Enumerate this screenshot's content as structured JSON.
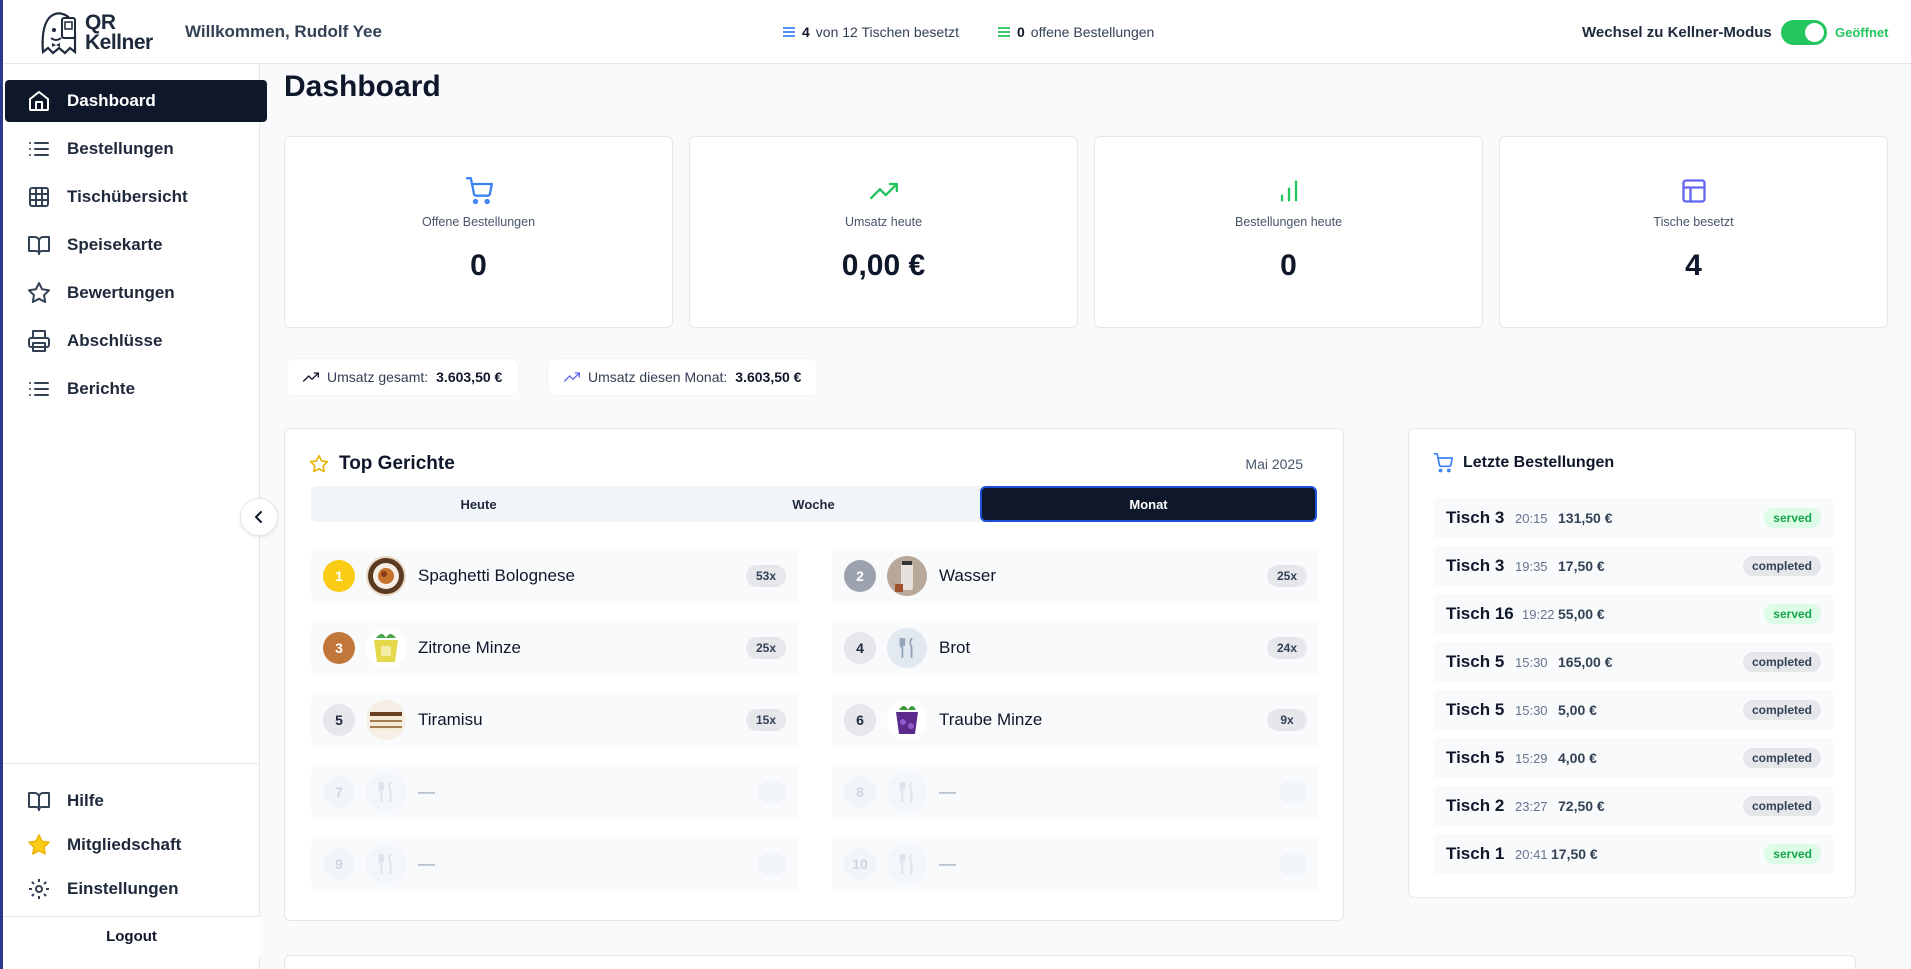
{
  "header": {
    "logo_line1": "QR",
    "logo_line2": "Kellner",
    "welcome": "Willkommen, Rudolf Yee",
    "tables_count": "4",
    "tables_text": "von 12 Tischen besetzt",
    "orders_count": "0",
    "orders_text": "offene Bestellungen",
    "mode_switch_label": "Wechsel zu Kellner-Modus",
    "open_status": "Geöffnet"
  },
  "sidebar": {
    "items": [
      {
        "label": "Dashboard",
        "icon": "home-icon"
      },
      {
        "label": "Bestellungen",
        "icon": "list-icon"
      },
      {
        "label": "Tischübersicht",
        "icon": "grid-icon"
      },
      {
        "label": "Speisekarte",
        "icon": "book-icon"
      },
      {
        "label": "Bewertungen",
        "icon": "star-icon"
      },
      {
        "label": "Abschlüsse",
        "icon": "printer-icon"
      },
      {
        "label": "Berichte",
        "icon": "list-icon"
      }
    ],
    "bottom_items": [
      {
        "label": "Hilfe",
        "icon": "book-icon"
      },
      {
        "label": "Mitgliedschaft",
        "icon": "star-icon"
      },
      {
        "label": "Einstellungen",
        "icon": "gear-icon"
      }
    ],
    "logout": "Logout"
  },
  "main": {
    "title": "Dashboard",
    "kpis": [
      {
        "label": "Offene Bestellungen",
        "value": "0",
        "icon": "cart-icon",
        "color": "#3b82f6"
      },
      {
        "label": "Umsatz heute",
        "value": "0,00 €",
        "icon": "trending-up-icon",
        "color": "#22c55e"
      },
      {
        "label": "Bestellungen heute",
        "value": "0",
        "icon": "bar-chart-icon",
        "color": "#22c55e"
      },
      {
        "label": "Tische besetzt",
        "value": "4",
        "icon": "table-icon",
        "color": "#6366f1"
      }
    ],
    "revenue_total_label": "Umsatz gesamt:",
    "revenue_total_value": "3.603,50 €",
    "revenue_month_label": "Umsatz diesen Monat:",
    "revenue_month_value": "3.603,50 €"
  },
  "top_dishes": {
    "title": "Top Gerichte",
    "period": "Mai 2025",
    "tabs": [
      "Heute",
      "Woche",
      "Monat"
    ],
    "active_tab": "Monat",
    "items": [
      {
        "rank": "1",
        "name": "Spaghetti Bolognese",
        "count": "53x"
      },
      {
        "rank": "2",
        "name": "Wasser",
        "count": "25x"
      },
      {
        "rank": "3",
        "name": "Zitrone Minze",
        "count": "25x"
      },
      {
        "rank": "4",
        "name": "Brot",
        "count": "24x"
      },
      {
        "rank": "5",
        "name": "Tiramisu",
        "count": "15x"
      },
      {
        "rank": "6",
        "name": "Traube Minze",
        "count": "9x"
      },
      {
        "rank": "7",
        "name": "—",
        "count": ""
      },
      {
        "rank": "8",
        "name": "—",
        "count": ""
      },
      {
        "rank": "9",
        "name": "—",
        "count": ""
      },
      {
        "rank": "10",
        "name": "—",
        "count": ""
      }
    ]
  },
  "recent_orders": {
    "title": "Letzte Bestellungen",
    "items": [
      {
        "table": "Tisch 3",
        "time": "20:15",
        "amount": "131,50 €",
        "status": "served"
      },
      {
        "table": "Tisch 3",
        "time": "19:35",
        "amount": "17,50 €",
        "status": "completed"
      },
      {
        "table": "Tisch 16",
        "time": "19:22",
        "amount": "55,00 €",
        "status": "served"
      },
      {
        "table": "Tisch 5",
        "time": "15:30",
        "amount": "165,00 €",
        "status": "completed"
      },
      {
        "table": "Tisch 5",
        "time": "15:30",
        "amount": "5,00 €",
        "status": "completed"
      },
      {
        "table": "Tisch 5",
        "time": "15:29",
        "amount": "4,00 €",
        "status": "completed"
      },
      {
        "table": "Tisch 2",
        "time": "23:27",
        "amount": "72,50 €",
        "status": "completed"
      },
      {
        "table": "Tisch 1",
        "time": "20:41",
        "amount": "17,50 €",
        "status": "served"
      }
    ]
  }
}
